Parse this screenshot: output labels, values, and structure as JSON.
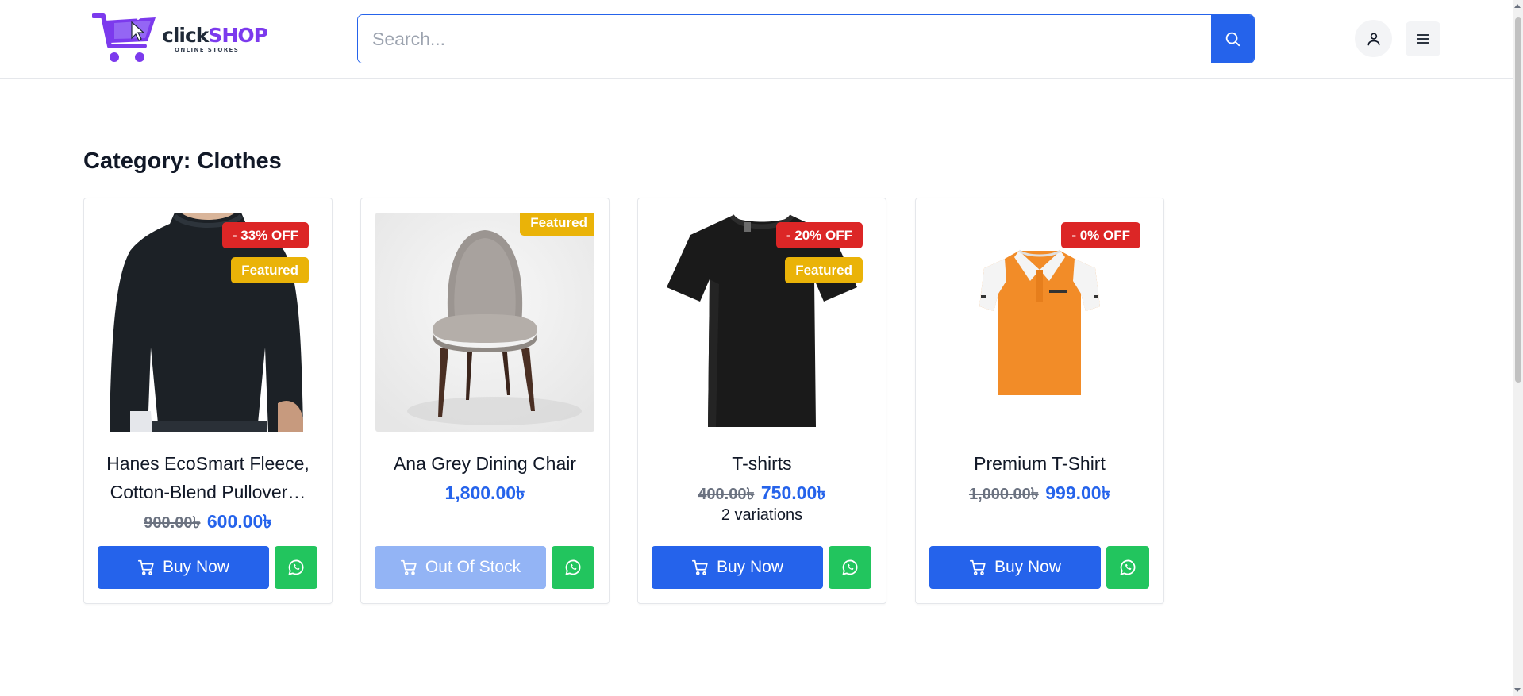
{
  "header": {
    "logo": {
      "text_part1": "click",
      "text_part2": "SHOP",
      "tagline": "ONLINE STORES"
    },
    "search": {
      "placeholder": "Search...",
      "value": ""
    }
  },
  "main": {
    "category_title": "Category: Clothes"
  },
  "products": [
    {
      "title_line1": "Hanes EcoSmart Fleece,",
      "title_line2": "Cotton-Blend Pullover…",
      "discount_badge": "- 33% OFF",
      "featured_badge": "Featured",
      "old_price": "900.00৳",
      "new_price": "600.00৳",
      "button_label": "Buy Now",
      "image_icon": "black-sweatshirt-image"
    },
    {
      "title_line1": "Ana Grey Dining Chair",
      "featured_badge": "Featured",
      "new_price": "1,800.00৳",
      "button_label": "Out Of Stock",
      "image_icon": "grey-chair-image"
    },
    {
      "title_line1": "T-shirts",
      "discount_badge": "- 20% OFF",
      "featured_badge": "Featured",
      "old_price": "400.00৳",
      "new_price": "750.00৳",
      "variations": "2 variations",
      "button_label": "Buy Now",
      "image_icon": "black-tshirt-image"
    },
    {
      "title_line1": "Premium T-Shirt",
      "discount_badge": "- 0% OFF",
      "old_price": "1,000.00৳",
      "new_price": "999.00৳",
      "button_label": "Buy Now",
      "image_icon": "orange-polo-image"
    }
  ],
  "colors": {
    "primary": "#2563eb",
    "discount_badge": "#dc2626",
    "featured_badge": "#eab308",
    "whatsapp": "#22c55e",
    "out_of_stock": "#93b4f5"
  }
}
